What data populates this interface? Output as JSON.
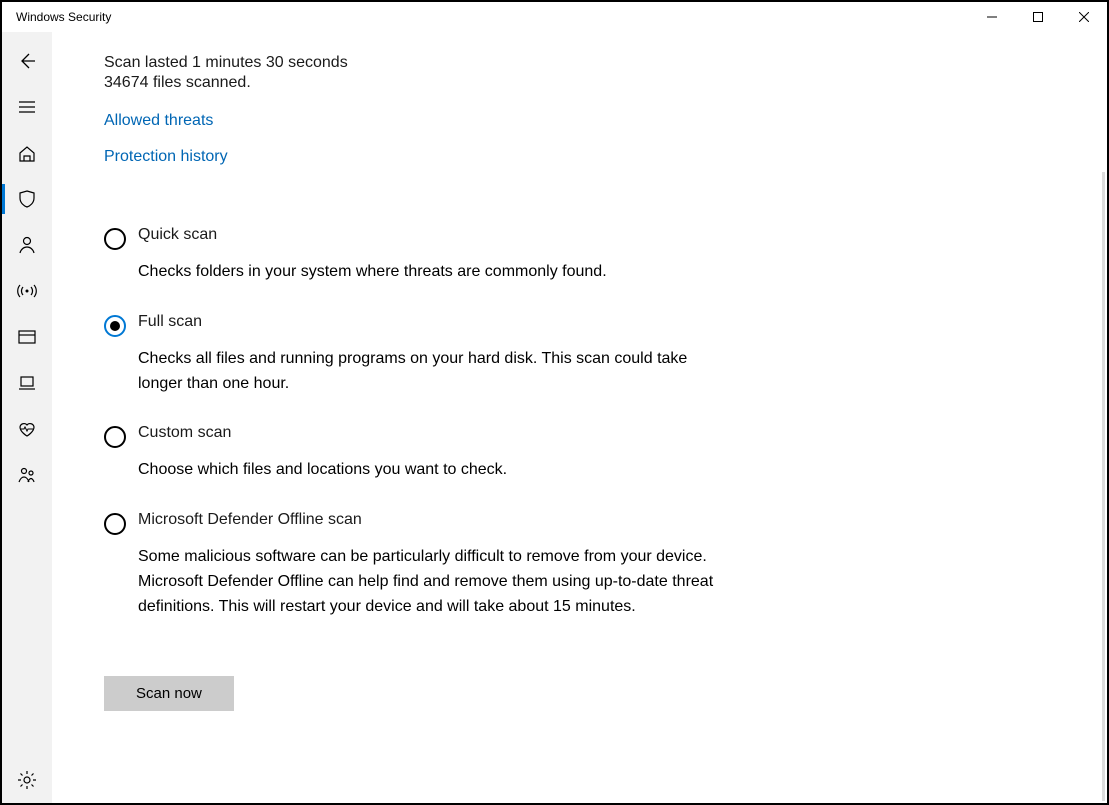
{
  "window": {
    "title": "Windows Security"
  },
  "sidebar": {
    "items": [
      {
        "name": "back",
        "icon": "back-arrow-icon",
        "selected": false
      },
      {
        "name": "menu",
        "icon": "hamburger-icon",
        "selected": false
      },
      {
        "name": "home",
        "icon": "home-icon",
        "selected": false
      },
      {
        "name": "shield",
        "icon": "shield-icon",
        "selected": true
      },
      {
        "name": "account",
        "icon": "person-icon",
        "selected": false
      },
      {
        "name": "firewall",
        "icon": "antenna-icon",
        "selected": false
      },
      {
        "name": "app",
        "icon": "app-window-icon",
        "selected": false
      },
      {
        "name": "device",
        "icon": "laptop-icon",
        "selected": false
      },
      {
        "name": "health",
        "icon": "heart-icon",
        "selected": false
      },
      {
        "name": "family",
        "icon": "family-icon",
        "selected": false
      }
    ],
    "settings_icon": "gear-icon"
  },
  "main": {
    "status_line1": "Scan lasted 1 minutes 30 seconds",
    "status_line2": "34674 files scanned.",
    "links": {
      "allowed_threats": "Allowed threats",
      "protection_history": "Protection history"
    },
    "options": [
      {
        "id": "quick",
        "title": "Quick scan",
        "desc": "Checks folders in your system where threats are commonly found.",
        "selected": false
      },
      {
        "id": "full",
        "title": "Full scan",
        "desc": "Checks all files and running programs on your hard disk. This scan could take longer than one hour.",
        "selected": true
      },
      {
        "id": "custom",
        "title": "Custom scan",
        "desc": "Choose which files and locations you want to check.",
        "selected": false
      },
      {
        "id": "offline",
        "title": "Microsoft Defender Offline scan",
        "desc": "Some malicious software can be particularly difficult to remove from your device. Microsoft Defender Offline can help find and remove them using up-to-date threat definitions. This will restart your device and will take about 15 minutes.",
        "selected": false
      }
    ],
    "scan_button": "Scan now"
  }
}
